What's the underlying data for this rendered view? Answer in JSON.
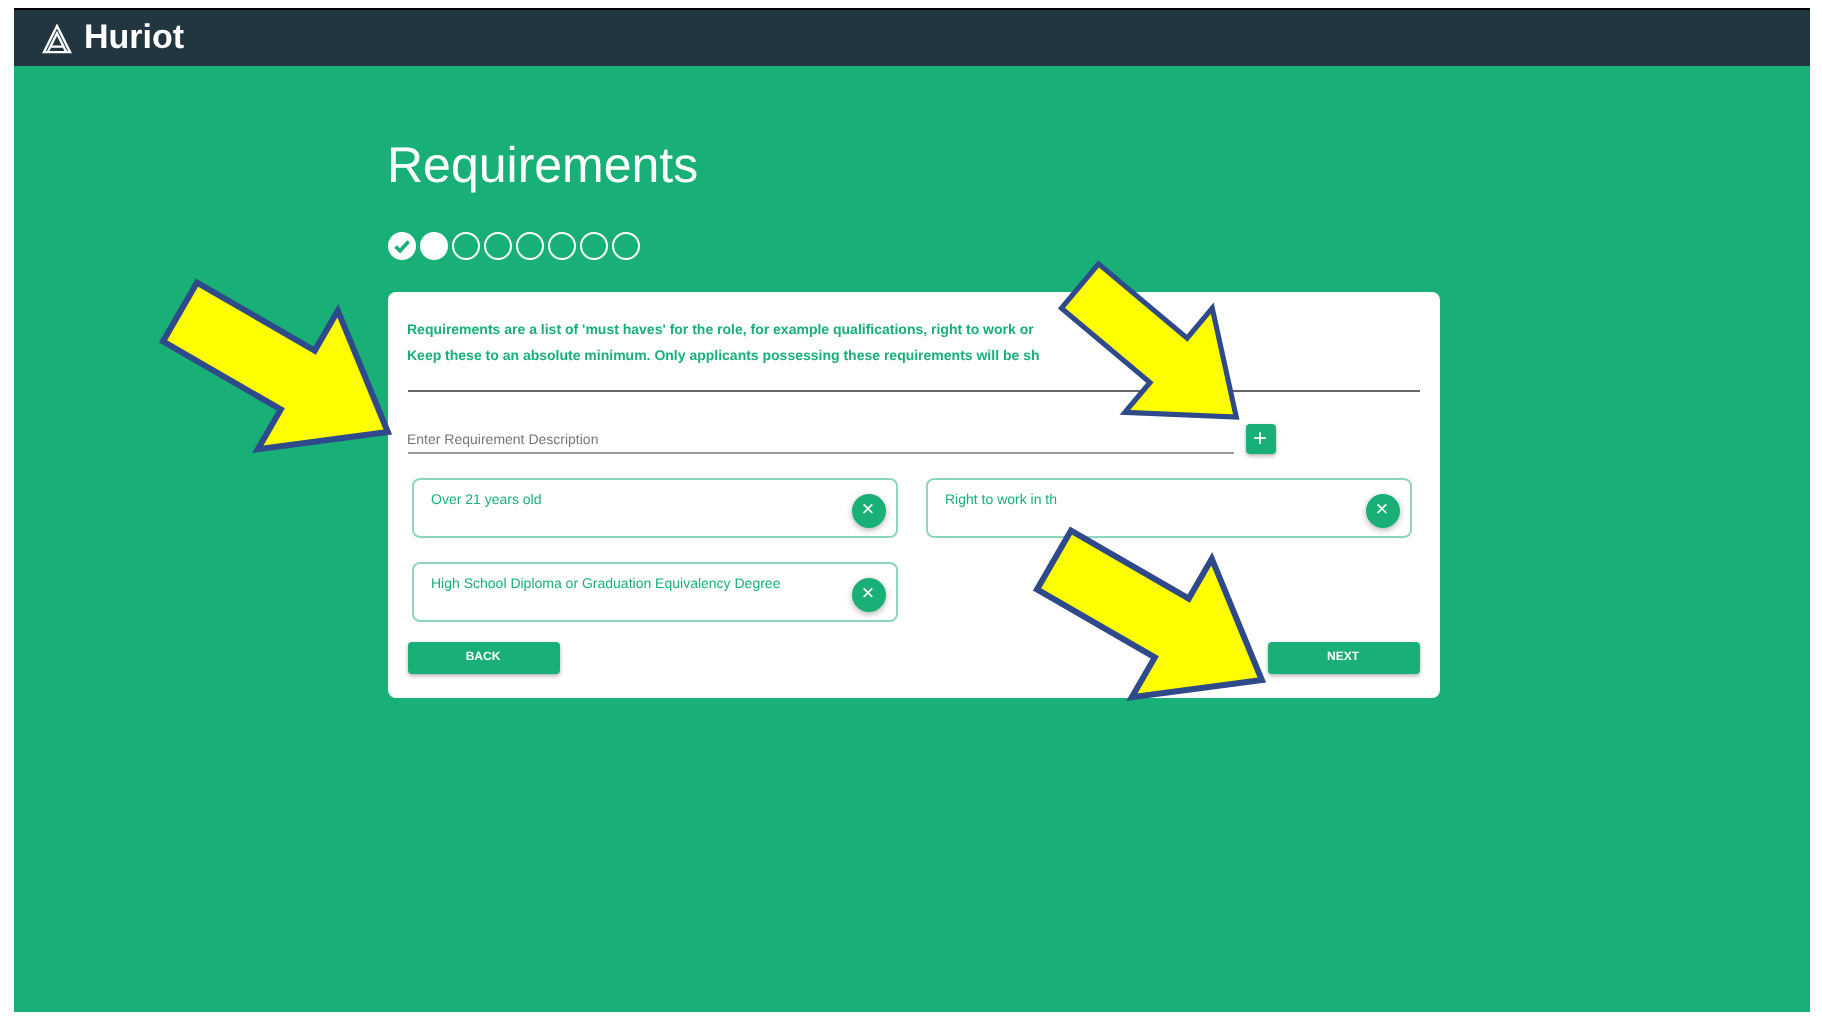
{
  "header": {
    "brand": "Huriot"
  },
  "page": {
    "title": "Requirements"
  },
  "steps": [
    {
      "kind": "done"
    },
    {
      "kind": "current"
    },
    {
      "kind": "todo"
    },
    {
      "kind": "todo"
    },
    {
      "kind": "todo"
    },
    {
      "kind": "todo"
    },
    {
      "kind": "todo"
    },
    {
      "kind": "todo"
    }
  ],
  "intro": [
    "Requirements are a list of 'must haves' for the role, for example qualifications, right to work or",
    "Keep these to an absolute minimum. Only applicants possessing these requirements will be sh"
  ],
  "input": {
    "placeholder": "Enter Requirement Description",
    "add_label": "+"
  },
  "requirements": [
    {
      "text": "Over 21 years old",
      "remove_label": "×"
    },
    {
      "text": "Right to work in th",
      "remove_label": "×"
    },
    {
      "text": "High School Diploma or Graduation Equivalency Degree",
      "remove_label": "×"
    }
  ],
  "buttons": {
    "back": "BACK",
    "next": "NEXT"
  }
}
